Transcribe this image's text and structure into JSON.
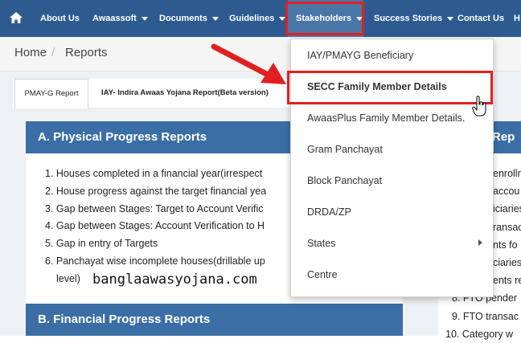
{
  "nav": {
    "about": "About Us",
    "awaassoft": "Awaassoft",
    "documents": "Documents",
    "guidelines": "Guidelines",
    "stakeholders": "Stakeholders",
    "success": "Success Stories",
    "contact": "Contact Us",
    "more": "H"
  },
  "breadcrumb": {
    "home": "Home",
    "sep": "/",
    "current": "Reports"
  },
  "tabs": {
    "pmayg": "PMAY-G Report",
    "iay": "IAY- Indira Awaas Yojana Report(Beta version)"
  },
  "panel_a": {
    "title": "A. Physical Progress Reports",
    "items": [
      "1. Houses completed in a financial year(irrespect",
      "2. House progress against the target financial yea",
      "3. Gap between Stages: Target to Account Verific",
      "4. Gap between Stages: Account Verification to H",
      "5. Gap in entry of Targets",
      "6. Panchayat wise incomplete houses(drillable up",
      "level)"
    ]
  },
  "panel_b": {
    "title": "B. Financial Progress Reports"
  },
  "right_panel": {
    "title": "Rep",
    "items": [
      "enrolln",
      "accou",
      "iciaries",
      "ransac",
      "nts fo",
      "ciaries",
      "ents re",
      "8. FTO pender",
      "9. FTO transac",
      "10. Category w"
    ]
  },
  "dropdown": {
    "items": [
      "IAY/PMAYG Beneficiary",
      "SECC Family Member Details",
      "AwaasPlus Family Member Details.",
      "Gram Panchayat",
      "Block Panchayat",
      "DRDA/ZP",
      "States",
      "Centre"
    ]
  },
  "watermark": "banglaawasyojana.com",
  "colors": {
    "nav": "#2e5b8f",
    "panel_header": "#3a6ea5",
    "highlight": "#e02020"
  }
}
